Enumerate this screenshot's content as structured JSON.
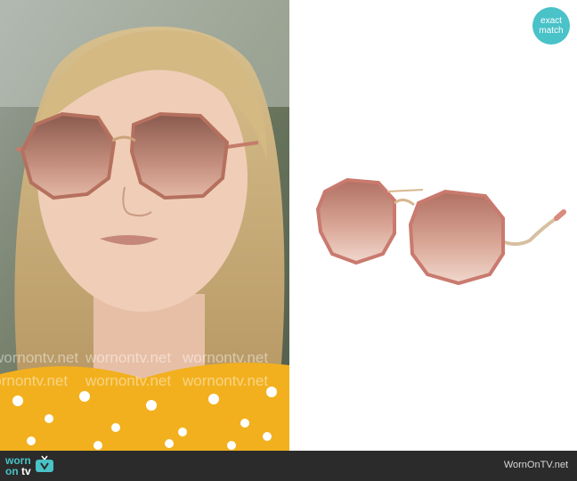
{
  "badge": {
    "line1": "exact",
    "line2": "match"
  },
  "watermark": {
    "text": "wornontv.net"
  },
  "footer": {
    "logo_main": "worn",
    "logo_on": "on",
    "logo_tv": "tv",
    "site": "WornOnTV.net"
  },
  "colors": {
    "accent": "#49c2c8",
    "footer_bg": "#2b2b2b",
    "lens": "#c98778",
    "frame": "#c97a6e",
    "shirt": "#f2b01e"
  }
}
